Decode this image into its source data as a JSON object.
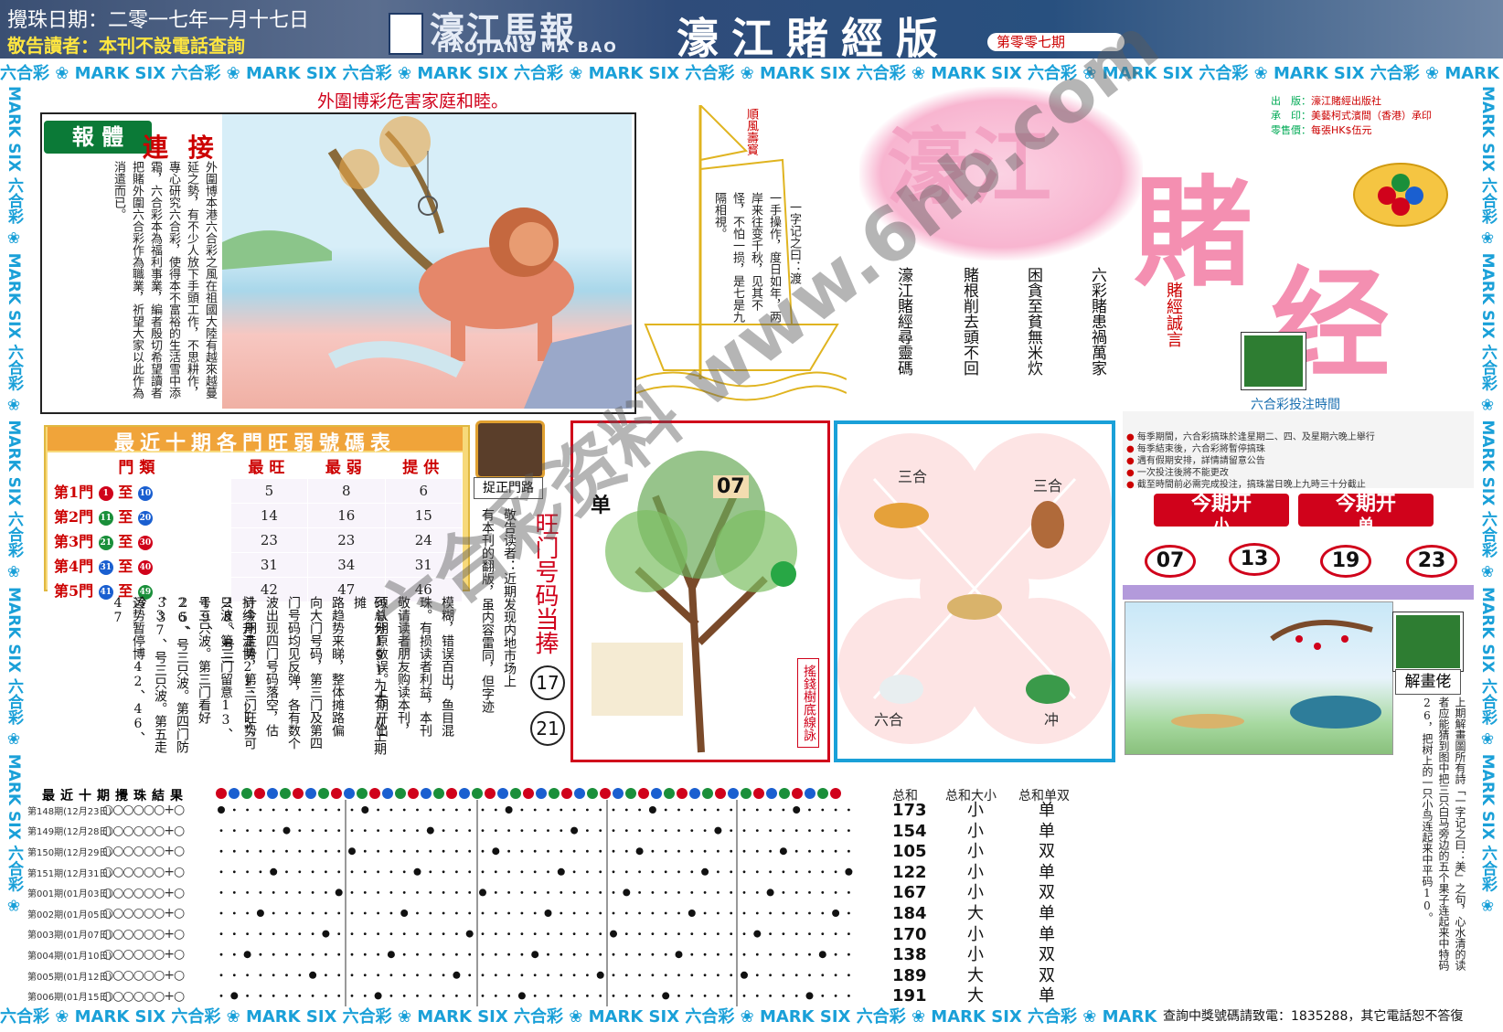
{
  "header": {
    "date": "攪珠日期：二零一七年一月十七日",
    "notice": "敬告讀者：本刊不設電話查詢",
    "logo": "濠江馬報",
    "logo_en": "HAOJIANG MA BAO",
    "edition": "濠江賭經版",
    "issue": "第零零七期"
  },
  "strip": "六合彩 ❀ MARK SIX 六合彩 ❀ MARK SIX 六合彩 ❀ MARK SIX 六合彩 ❀ MARK SIX 六合彩 ❀ MARK SIX 六合彩 ❀ MARK SIX 六合彩 ❀ MARK SIX 六合彩 ❀ MARK SIX 六合彩 ❀ MARK SIX 六合彩 ❀ MARK SIX",
  "side_strip": "MARK SIX 六合彩 ❀ MARK SIX 六合彩 ❀ MARK SIX 六合彩 ❀ MARK SIX 六合彩 ❀ MARK SIX 六合彩 ❀",
  "story": {
    "title": "外圍博彩危害家庭和睦。",
    "label1": "報 體",
    "label2": "連 接",
    "text": "外圍博本港六合彩之風在祖國大陸有越來越蔓延之勢，有不少人放下手頭工作，不思耕作，專心研究六合彩，使得本不富裕的生活雪中添霜，六合彩本為福利事業，編者殷切希望讀者把賭外圍六合彩作為職業，祈望大家以此作為消遣而已。"
  },
  "boat": {
    "flag": "順風壽寳",
    "verse_a": "一字记之曰：渡",
    "verse_b": "一手操作，度日如年，两岸来往变千秋，见其不怪，不怕一损，是七是九隔相視。"
  },
  "verses": [
    "六彩賭患禍萬家",
    "困貪至貧無米炊",
    "賭根削去頭不回",
    "濠江賭經尋靈碼"
  ],
  "honest_word": "賭經誠言",
  "big_logo": [
    "濠江",
    "賭",
    "经"
  ],
  "publisher": [
    {
      "k": "出　版：",
      "v": "濠江賭經出版社"
    },
    {
      "k": "承　印：",
      "v": "美藝柯式濱間（香港）承印"
    },
    {
      "k": "零售價：",
      "v": "每張HK$伍元"
    }
  ],
  "table": {
    "title": "最近十期各門旺弱號碼表",
    "headers": [
      "門類",
      "最旺",
      "最弱",
      "提供"
    ],
    "rows": [
      {
        "door": "第1門",
        "from": "1",
        "to": "10",
        "hot": "5",
        "weak": "8",
        "give": "6"
      },
      {
        "door": "第2門",
        "from": "11",
        "to": "20",
        "hot": "14",
        "weak": "16",
        "give": "15"
      },
      {
        "door": "第3門",
        "from": "21",
        "to": "30",
        "hot": "23",
        "weak": "23",
        "give": "24"
      },
      {
        "door": "第4門",
        "from": "31",
        "to": "40",
        "hot": "31",
        "weak": "34",
        "give": "31"
      },
      {
        "door": "第5門",
        "from": "41",
        "to": "49",
        "hot": "42",
        "weak": "47",
        "give": "46"
      }
    ],
    "between": "至"
  },
  "column_text": [
    "运势暂停博42、46、47",
    "、37、号三只波。第五走冷",
    "26、号三只波。第四门防33",
    "号三只波。第三门看好25、",
    "只波。第二门留意13、19、",
    "持续升温博21、25、28、号三",
    "计今期走势，第三门旺势可",
    "波出现四门号码落空，估",
    "门号码均见反弹，各有数个",
    "向大门号码，第三门及第四",
    "路趋势来睇，整体摊路偏",
    "码总分191为大，从上期摊",
    "须认明原数误。上期开出",
    "敬请读者朋友购读本刊，",
    "珠。有损读者利益，本刊",
    "模糊，错误百出，鱼目混"
  ],
  "notice_col": [
    "敬告读者：近期发现内地市场上",
    "有本刊的翻版，虽内容雷同，但字迹"
  ],
  "correct_door": {
    "label": "捉正門路"
  },
  "hot_title": "旺门号码当捧",
  "hot_numbers": [
    "17",
    "21"
  ],
  "tree": {
    "left_word": "单",
    "right_num": "07",
    "sign": "搖錢樹底線詠"
  },
  "zodiac": {
    "tl": "三合",
    "tr": "三合",
    "bl": "六合",
    "br": "冲"
  },
  "right": {
    "bet_time": "六合彩投注時間",
    "rules": [
      "每季期間，六合彩搞珠於逢星期二、四、及星期六晚上舉行",
      "每季結束後，六合彩將暫停搞珠",
      "遇有假期安排，詳情請留意公告",
      "一次投注後將不能更改",
      "截至時間前必需完成投注，搞珠當日晚上九時三十分截止"
    ],
    "open1_title": "今期开",
    "open1_val": "小",
    "open2_title": "今期开",
    "open2_val": "单",
    "result_nums": [
      "07",
      "13",
      "19",
      "23"
    ],
    "jie_label": "解畫佬",
    "hint": "上期解畫圖所有詩「一字记之曰：美」之句，心水清的读者应能猜到图中把三只白马旁边的五个果子连起来中特码26，把树上的一只小鸟连起来中平码10。"
  },
  "results": {
    "title": "最近十期攪珠結果",
    "periods": [
      "第148期(12月23日)",
      "第149期(12月28日)",
      "第150期(12月29日)",
      "第151期(12月31日)",
      "第001期(01月03日)",
      "第002期(01月05日)",
      "第003期(01月07日)",
      "第004期(01月10日)",
      "第005期(01月12日)",
      "第006期(01月15日)"
    ],
    "balls": "○○○○○○+○",
    "stat_headers": [
      "总和",
      "总和大小",
      "总和单双"
    ],
    "sums": [
      "173",
      "154",
      "105",
      "122",
      "167",
      "184",
      "170",
      "138",
      "189",
      "191"
    ],
    "size": [
      "小",
      "小",
      "小",
      "小",
      "小",
      "大",
      "小",
      "小",
      "大",
      "大"
    ],
    "parity": [
      "单",
      "单",
      "双",
      "单",
      "双",
      "单",
      "单",
      "双",
      "双",
      "单"
    ]
  },
  "footer": "查詢中獎號碼請致電：1835288，其它電話恕不答復",
  "watermark": "六合彩资料 www.6hb.com"
}
